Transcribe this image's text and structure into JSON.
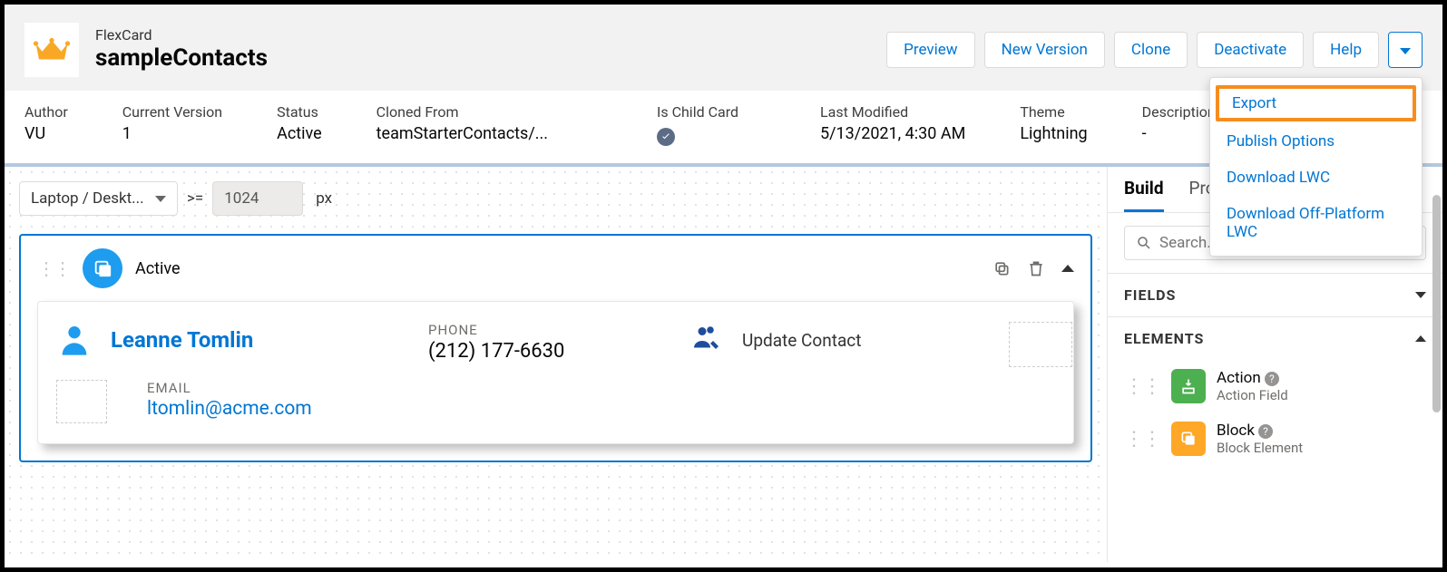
{
  "header": {
    "type_label": "FlexCard",
    "title": "sampleContacts",
    "actions": {
      "preview": "Preview",
      "new_version": "New Version",
      "clone": "Clone",
      "deactivate": "Deactivate",
      "help": "Help"
    }
  },
  "dropdown": {
    "export": "Export",
    "publish_options": "Publish Options",
    "download_lwc": "Download LWC",
    "download_off_platform": "Download Off-Platform LWC"
  },
  "meta": {
    "author_lbl": "Author",
    "author_val": "VU",
    "current_version_lbl": "Current Version",
    "current_version_val": "1",
    "status_lbl": "Status",
    "status_val": "Active",
    "cloned_from_lbl": "Cloned From",
    "cloned_from_val": "teamStarterContacts/...",
    "is_child_lbl": "Is Child Card",
    "last_modified_lbl": "Last Modified",
    "last_modified_val": "5/13/2021, 4:30 AM",
    "theme_lbl": "Theme",
    "theme_val": "Lightning",
    "description_lbl": "Description",
    "description_val": "-"
  },
  "canvas": {
    "device_label": "Laptop / Deskt...",
    "operator": ">=",
    "width_value": "1024",
    "px_label": "px"
  },
  "state": {
    "label": "Active"
  },
  "card": {
    "contact_name": "Leanne Tomlin",
    "phone_lbl": "PHONE",
    "phone_val": "(212) 177-6630",
    "update_lbl": "Update Contact",
    "email_lbl": "EMAIL",
    "email_val": "ltomlin@acme.com"
  },
  "panel": {
    "tabs": {
      "build": "Build",
      "properties": "Prope"
    },
    "search_placeholder": "Search...",
    "fields_section": "FIELDS",
    "elements_section": "ELEMENTS",
    "elements": [
      {
        "title": "Action",
        "subtitle": "Action Field"
      },
      {
        "title": "Block",
        "subtitle": "Block Element"
      }
    ]
  }
}
